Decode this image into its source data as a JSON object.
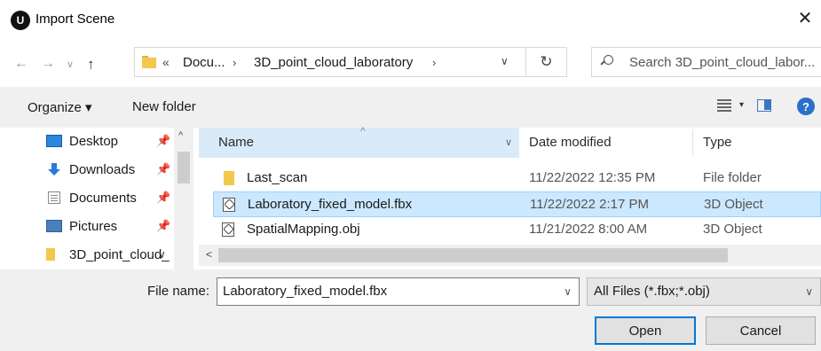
{
  "window": {
    "title": "Import Scene",
    "app_icon_glyph": "U",
    "close_glyph": "✕"
  },
  "nav": {
    "back_glyph": "←",
    "forward_glyph": "→",
    "recent_glyph": "∨",
    "up_glyph": "↑"
  },
  "address": {
    "overflow": "«",
    "segments": [
      "Docu...",
      "3D_point_cloud_laboratory"
    ],
    "separator": "›",
    "dropdown_glyph": "∨",
    "refresh_glyph": "↻"
  },
  "search": {
    "placeholder": "Search 3D_point_cloud_labor..."
  },
  "toolbar": {
    "organize": "Organize ▾",
    "new_folder": "New folder",
    "view_dropdown": "▾",
    "help": "?"
  },
  "sidebar": {
    "items": [
      {
        "label": "Desktop",
        "icon": "desktop-icon",
        "pin": "📌"
      },
      {
        "label": "Downloads",
        "icon": "downloads-icon",
        "pin": "📌"
      },
      {
        "label": "Documents",
        "icon": "documents-icon",
        "pin": "📌"
      },
      {
        "label": "Pictures",
        "icon": "pictures-icon",
        "pin": "📌"
      },
      {
        "label": "3D_point_cloud_",
        "icon": "folder-icon",
        "pin": "∨"
      }
    ],
    "scroll_up_glyph": "^"
  },
  "columns": {
    "name": "Name",
    "sort_glyph": "^",
    "name_dropdown": "∨",
    "date": "Date modified",
    "type": "Type"
  },
  "files": [
    {
      "name": "Last_scan",
      "date": "11/22/2022 12:35 PM",
      "type": "File folder",
      "icon": "folder-icon",
      "selected": false
    },
    {
      "name": "Laboratory_fixed_model.fbx",
      "date": "11/22/2022 2:17 PM",
      "type": "3D Object",
      "icon": "3d-object-icon",
      "selected": true
    },
    {
      "name": "SpatialMapping.obj",
      "date": "11/21/2022 8:00 AM",
      "type": "3D Object",
      "icon": "3d-object-icon",
      "selected": false
    }
  ],
  "hscroll": {
    "left_glyph": "<"
  },
  "bottom": {
    "file_name_label": "File name:",
    "file_name_value": "Laboratory_fixed_model.fbx",
    "file_name_dropdown": "∨",
    "file_type_value": "All Files (*.fbx;*.obj)",
    "file_type_dropdown": "∨",
    "open": "Open",
    "cancel": "Cancel"
  },
  "colors": {
    "selection_bg": "#cce8ff",
    "header_hover": "#d9ebf9",
    "accent": "#0078d7",
    "folder": "#f2c94c"
  }
}
